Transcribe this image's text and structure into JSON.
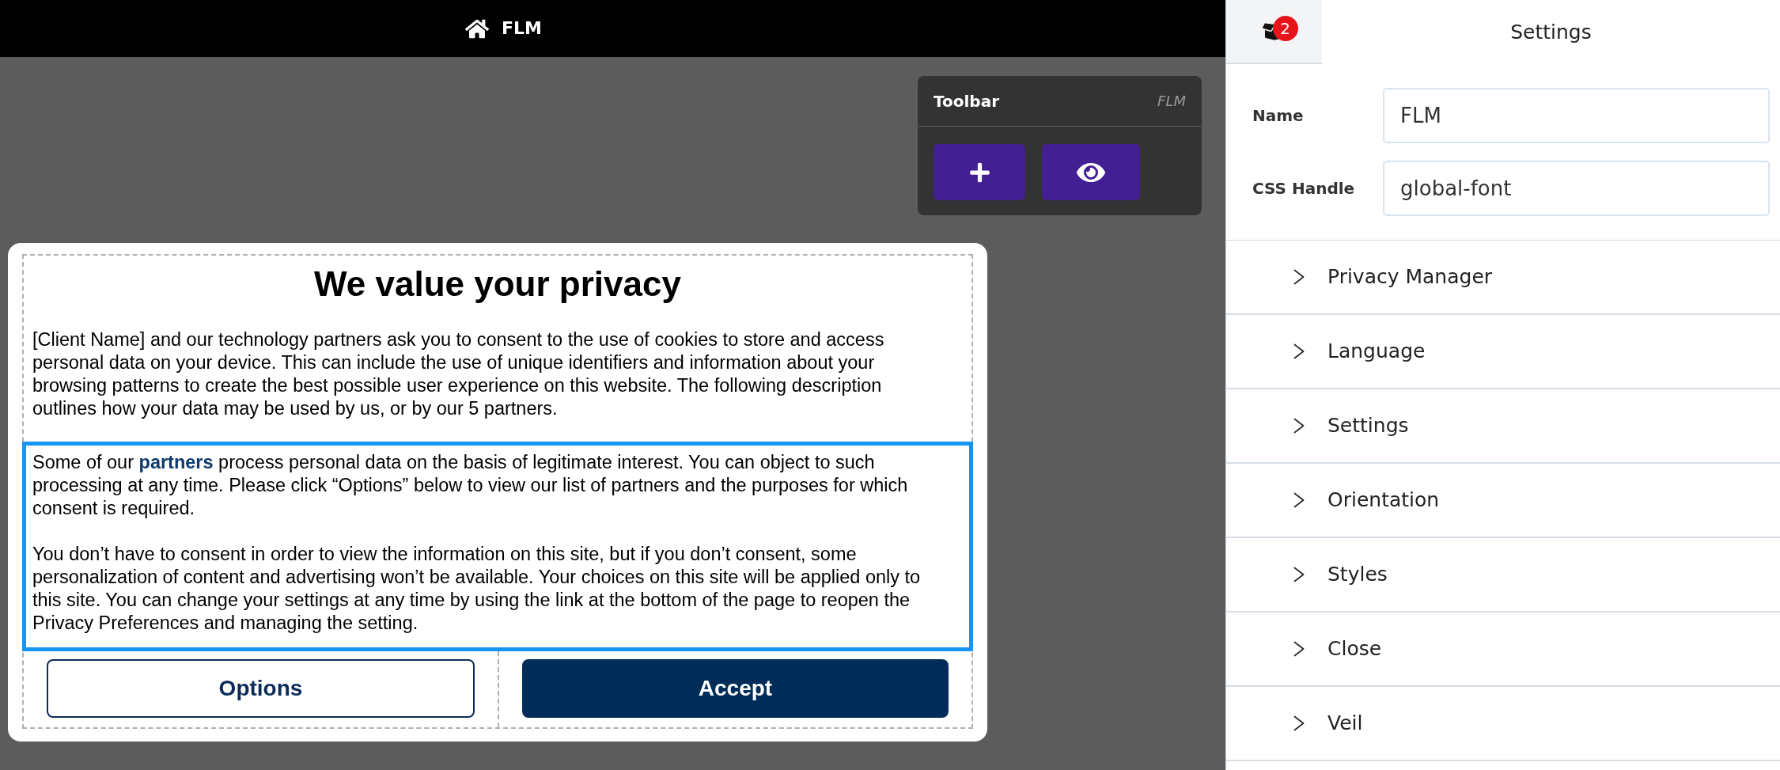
{
  "top_bar": {
    "title": "FLM"
  },
  "toolbar": {
    "title": "Toolbar",
    "tag": "FLM",
    "buttons": [
      {
        "kind": "add"
      },
      {
        "kind": "preview"
      }
    ]
  },
  "consent_dialog": {
    "title": "We value your privacy",
    "intro": "[Client Name] and our technology partners ask you to consent to the use of cookies to store and access personal data on your device. This can include the use of unique identifiers and information about your browsing patterns to create the best possible user experience on this website. The following description outlines how your data may be used by us, or by our 5 partners.",
    "notice": {
      "selected": true,
      "paragraphs": [
        {
          "segments": [
            {
              "kind": "text",
              "text": "Some of our "
            },
            {
              "kind": "link",
              "text": "partners"
            },
            {
              "kind": "text",
              "text": " process personal data on the basis of legitimate interest. You can object to such processing at any time. Please click “Options” below to view our list of partners and the purposes for which consent is required."
            }
          ]
        },
        {
          "segments": [
            {
              "kind": "text",
              "text": "You don’t have to consent in order to view the information on this site, but if you don’t consent, some personalization of content and advertising won’t be available. Your choices on this site will be applied only to this site. You can change your settings at any time by using the link at the bottom of the page to reopen the Privacy Preferences and managing the setting."
            }
          ]
        }
      ]
    },
    "buttons": [
      {
        "label": "Options",
        "kind": "outline"
      },
      {
        "label": "Accept",
        "kind": "solid"
      }
    ]
  },
  "settings_panel": {
    "tab": {
      "badge": "2"
    },
    "title": "Settings",
    "fields": [
      {
        "label": "Name",
        "value": "FLM"
      },
      {
        "label": "CSS Handle",
        "value": "global-font"
      }
    ],
    "sections": [
      {
        "label": "Privacy Manager",
        "expanded": false
      },
      {
        "label": "Language",
        "expanded": false
      },
      {
        "label": "Settings",
        "expanded": false
      },
      {
        "label": "Orientation",
        "expanded": false
      },
      {
        "label": "Styles",
        "expanded": false
      },
      {
        "label": "Close",
        "expanded": false
      },
      {
        "label": "Veil",
        "expanded": false
      }
    ]
  }
}
